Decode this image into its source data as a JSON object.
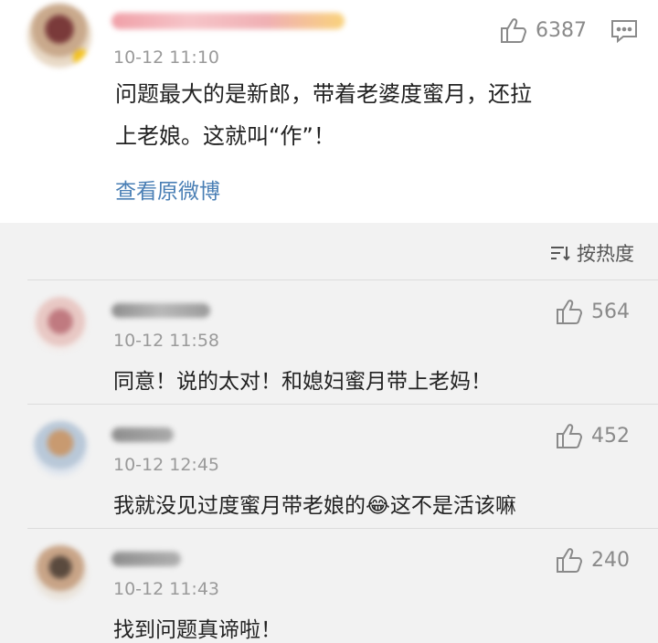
{
  "main_post": {
    "time": "10-12 11:10",
    "likes": "6387",
    "text_line1": "问题最大的是新郎，带着老婆度蜜月，还拉",
    "text_line2": "上老娘。这就叫“作”！",
    "view_original": "查看原微博"
  },
  "sort": {
    "label": "按热度"
  },
  "comments": [
    {
      "time": "10-12 11:58",
      "likes": "564",
      "text": "同意！说的太对！和媳妇蜜月带上老妈！"
    },
    {
      "time": "10-12 12:45",
      "likes": "452",
      "text_before": "我就没见过度蜜月带老娘的",
      "text_after": "这不是活该嘛",
      "emoji": "😂"
    },
    {
      "time": "10-12 11:43",
      "likes": "240",
      "text": "找到问题真谛啦！"
    }
  ],
  "icons": {
    "like": "thumbs-up-icon",
    "comment": "chat-bubble-icon",
    "sort": "sort-icon"
  },
  "colors": {
    "link": "#4a7fb5",
    "meta": "#9a9a9a"
  }
}
